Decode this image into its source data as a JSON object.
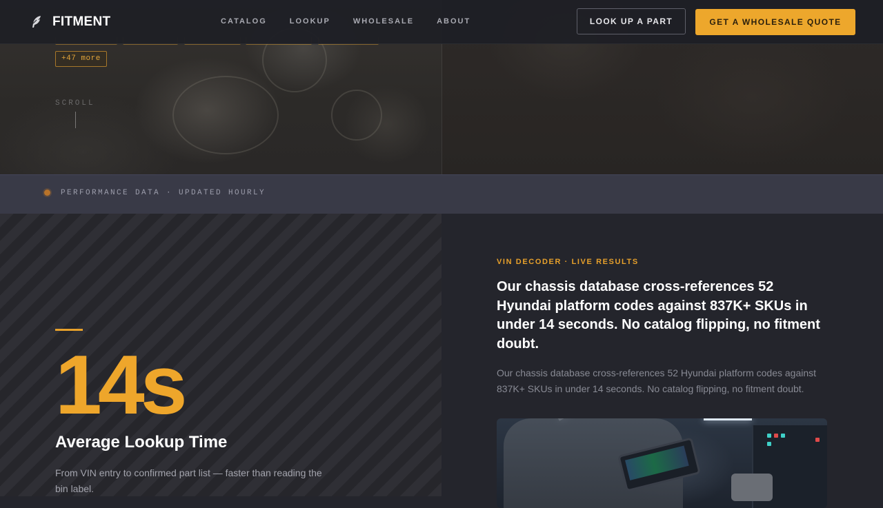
{
  "nav": {
    "logo_text": "FITMENT",
    "links": [
      "CATALOG",
      "LOOKUP",
      "WHOLESALE",
      "ABOUT"
    ],
    "lookup_button": "LOOK UP A PART",
    "quote_button": "GET A WHOLESALE QUOTE"
  },
  "hero": {
    "more_chip": "+47 more",
    "scroll_label": "SCROLL"
  },
  "band": {
    "text": "PERFORMANCE DATA · UPDATED HOURLY"
  },
  "stat": {
    "value": "14s",
    "label": "Average Lookup Time",
    "description": "From VIN entry to confirmed part list — faster than reading the bin label."
  },
  "feature": {
    "eyebrow": "VIN DECODER · LIVE RESULTS",
    "headline": "Our chassis database cross-references 52 Hyundai platform codes against 837K+ SKUs in under 14 seconds. No catalog flipping, no fitment doubt.",
    "body": "Our chassis database cross-references 52 Hyundai platform codes against 837K+ SKUs in under 14 seconds. No catalog flipping, no fitment doubt."
  },
  "colors": {
    "accent": "#eda72c",
    "background": "#24252c",
    "band": "#393a47"
  },
  "icons": {
    "logo": "feather-icon",
    "band_dot": "status-dot-icon"
  }
}
